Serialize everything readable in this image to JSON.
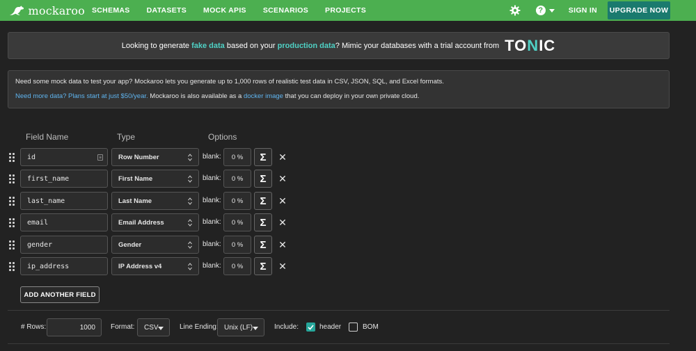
{
  "nav": {
    "brand": "mockaroo",
    "links": [
      "SCHEMAS",
      "DATASETS",
      "MOCK APIS",
      "SCENARIOS",
      "PROJECTS"
    ],
    "help_icon": "?",
    "signin": "SIGN IN",
    "upgrade": "UPGRADE NOW"
  },
  "promo": {
    "pre": "Looking to generate ",
    "hl1": "fake data",
    "mid": " based on your ",
    "hl2": "production data",
    "post": "? Mimic your databases with a trial account from",
    "logo_a": "TO",
    "logo_n": "N",
    "logo_b": "IC"
  },
  "info": {
    "line1": "Need some mock data to test your app? Mockaroo lets you generate up to 1,000 rows of realistic test data in CSV, JSON, SQL, and Excel formats.",
    "link1": "Need more data? Plans start at just $50/year.",
    "mid": " Mockaroo is also available as a ",
    "link2": "docker image",
    "post": " that you can deploy in your own private cloud."
  },
  "table": {
    "headers": {
      "field_name": "Field Name",
      "type": "Type",
      "options": "Options"
    },
    "blank_label": "blank:",
    "rows": [
      {
        "name": "id",
        "type": "Row Number",
        "blank": "0 %"
      },
      {
        "name": "first_name",
        "type": "First Name",
        "blank": "0 %"
      },
      {
        "name": "last_name",
        "type": "Last Name",
        "blank": "0 %"
      },
      {
        "name": "email",
        "type": "Email Address",
        "blank": "0 %"
      },
      {
        "name": "gender",
        "type": "Gender",
        "blank": "0 %"
      },
      {
        "name": "ip_address",
        "type": "IP Address v4",
        "blank": "0 %"
      }
    ],
    "sigma": "Σ",
    "remove": "✕",
    "add_field": "ADD ANOTHER FIELD"
  },
  "controls": {
    "rows_label": "# Rows:",
    "rows_value": "1000",
    "format_label": "Format:",
    "format_value": "CSV",
    "line_ending_label": "Line Ending:",
    "line_ending_value": "Unix (LF)",
    "include_label": "Include:",
    "header_label": "header",
    "header_checked": true,
    "bom_label": "BOM",
    "bom_checked": false
  },
  "colors": {
    "nav_bg": "#4caf50",
    "upgrade_bg": "#1a7a6e",
    "accent": "#4fd1c5",
    "link": "#5fb4ef"
  }
}
